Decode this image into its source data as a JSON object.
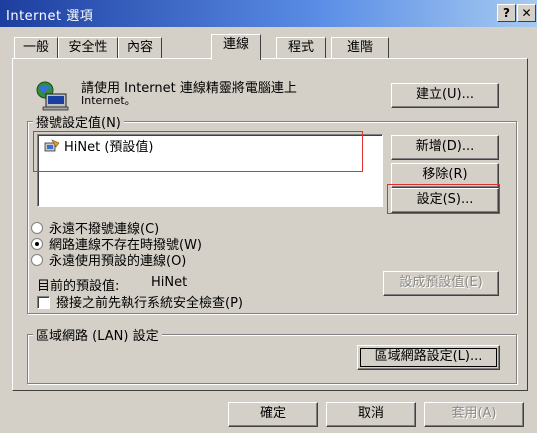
{
  "window": {
    "title": "Internet 選項",
    "help_btn": "?",
    "close_btn": "✕"
  },
  "tabs": [
    {
      "label": "一般"
    },
    {
      "label": "安全性"
    },
    {
      "label": "內容"
    },
    {
      "label": "連線",
      "active": true
    },
    {
      "label": "程式"
    },
    {
      "label": "進階"
    }
  ],
  "wizard": {
    "text_line1": "請使用 Internet 連線精靈將電腦連上",
    "text_line2": "Internet。",
    "setup_btn": "建立(U)..."
  },
  "dialup": {
    "group_label": "撥號設定值(N)",
    "connections": [
      {
        "name": "HiNet (預設值)"
      }
    ],
    "add_btn": "新增(D)...",
    "remove_btn": "移除(R)",
    "settings_btn": "設定(S)...",
    "options": [
      {
        "label": "永遠不撥號連線(C)",
        "selected": false
      },
      {
        "label": "網路連線不存在時撥號(W)",
        "selected": true
      },
      {
        "label": "永遠使用預設的連線(O)",
        "selected": false
      }
    ],
    "current_default_label": "目前的預設值:",
    "current_default_value": "HiNet",
    "set_default_btn": "設成預設值(E)",
    "security_check_label": "撥接之前先執行系統安全檢查(P)",
    "security_check_checked": false
  },
  "lan": {
    "group_label": "區域網路 (LAN) 設定",
    "settings_btn": "區域網路設定(L)..."
  },
  "footer": {
    "ok_btn": "確定",
    "cancel_btn": "取消",
    "apply_btn": "套用(A)"
  }
}
